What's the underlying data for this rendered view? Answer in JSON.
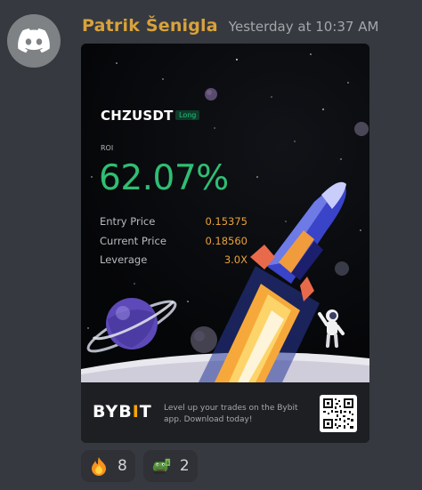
{
  "message": {
    "author": "Patrik Šenigla",
    "timestamp": "Yesterday at 10:37 AM",
    "avatar_icon": "discord-logo-icon"
  },
  "card": {
    "ticker": "CHZUSDT",
    "side": "Long",
    "roi_label": "ROI",
    "roi_value": "62.07%",
    "stats": [
      {
        "label": "Entry Price",
        "value": "0.15375"
      },
      {
        "label": "Current Price",
        "value": "0.18560"
      },
      {
        "label": "Leverage",
        "value": "3.0X"
      }
    ],
    "colors": {
      "roi": "#2fbe73",
      "stat_value": "#e9a13b",
      "brand_accent": "#f7a600"
    }
  },
  "banner": {
    "brand": "BYBIT",
    "brand_by": "BYB",
    "brand_bar": "I",
    "brand_t": "T",
    "promo_text": "Level up your trades on the Bybit app. Download today!"
  },
  "reactions": [
    {
      "emoji": "fire-emoji-icon",
      "count": "8"
    },
    {
      "emoji": "pepe-money-emoji-icon",
      "count": "2"
    }
  ]
}
